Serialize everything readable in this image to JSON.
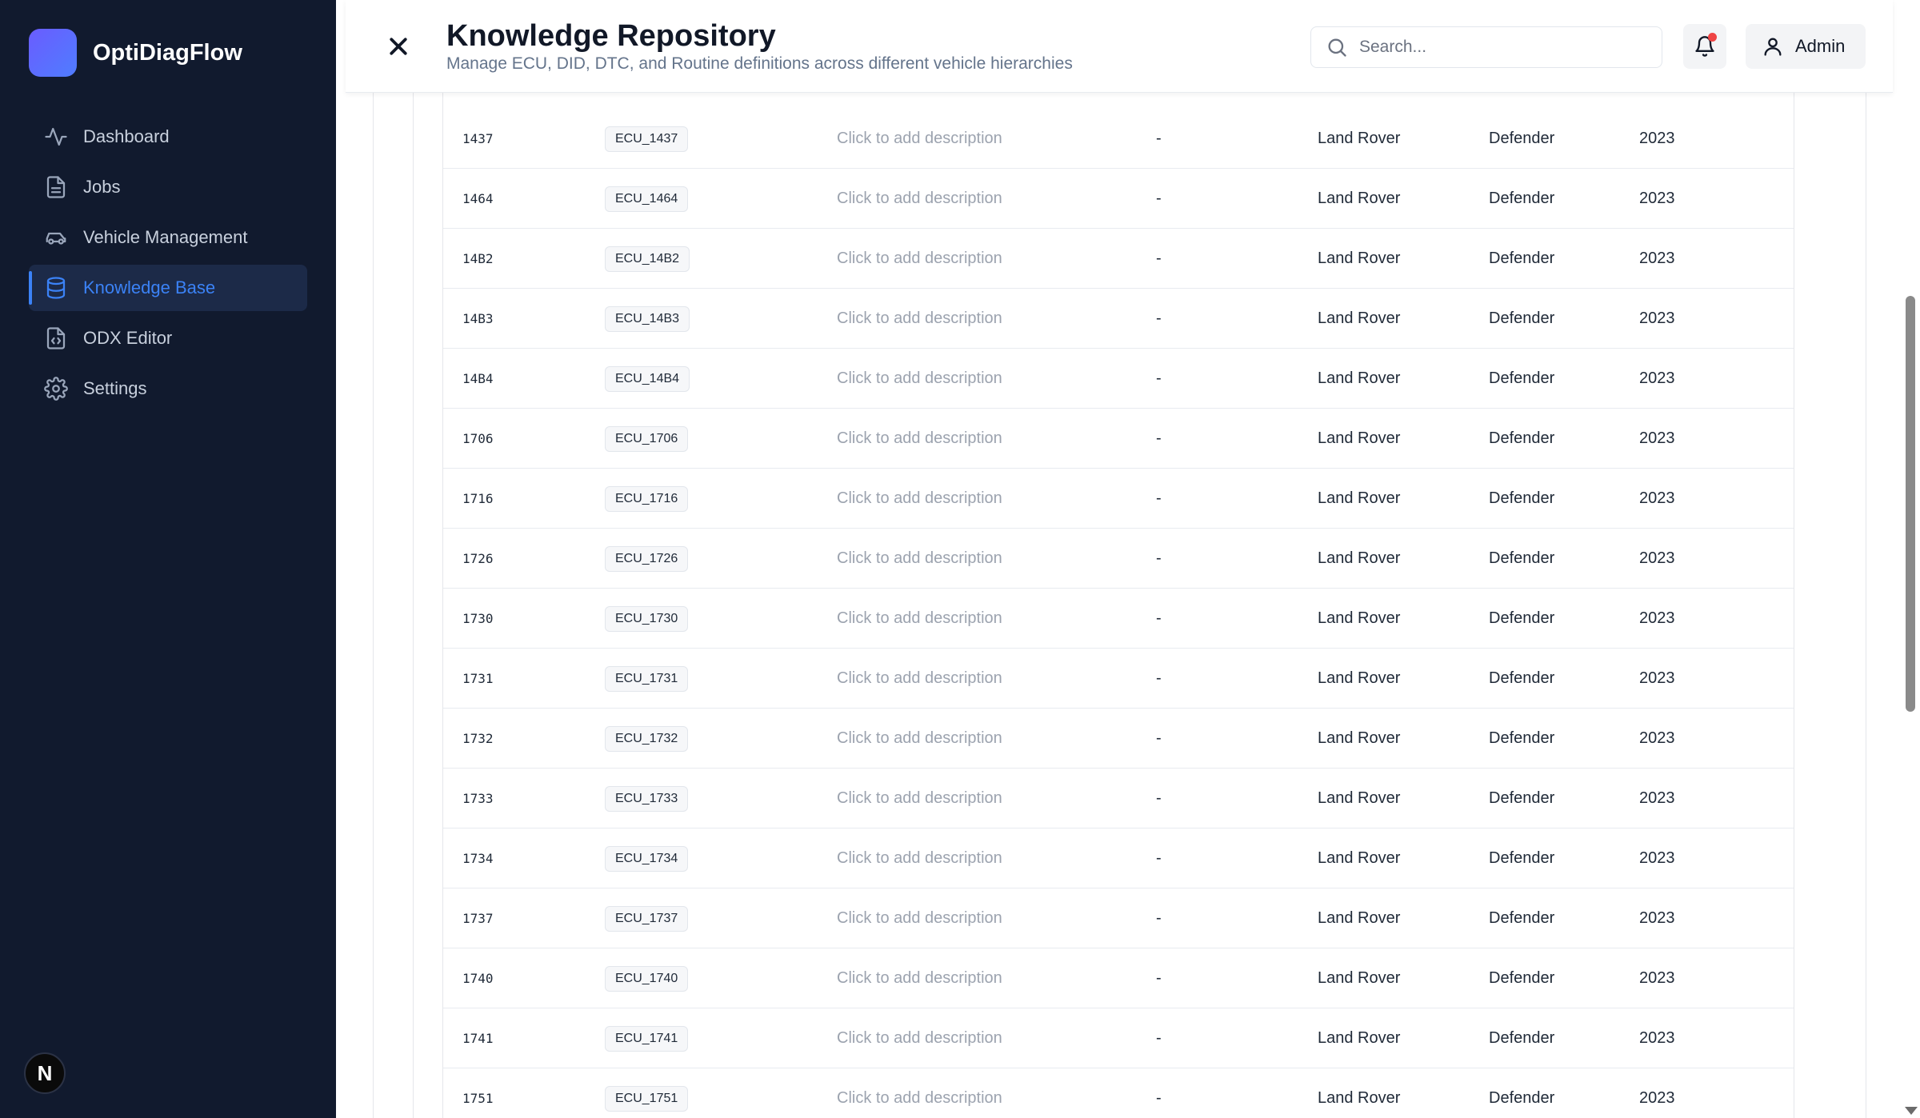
{
  "app": {
    "name": "OptiDiagFlow",
    "badge_letter": "N"
  },
  "sidebar": {
    "items": [
      {
        "label": "Dashboard",
        "icon": "activity-icon",
        "active": false
      },
      {
        "label": "Jobs",
        "icon": "document-icon",
        "active": false
      },
      {
        "label": "Vehicle Management",
        "icon": "car-icon",
        "active": false
      },
      {
        "label": "Knowledge Base",
        "icon": "database-icon",
        "active": true
      },
      {
        "label": "ODX Editor",
        "icon": "code-file-icon",
        "active": false
      },
      {
        "label": "Settings",
        "icon": "gear-icon",
        "active": false
      }
    ]
  },
  "header": {
    "title": "Knowledge Repository",
    "subtitle": "Manage ECU, DID, DTC, and Routine definitions across different vehicle hierarchies",
    "search_placeholder": "Search...",
    "user_label": "Admin"
  },
  "colors": {
    "sidebar_bg": "#111a2e",
    "accent": "#3b82f6",
    "notification_dot": "#ef4444"
  },
  "table": {
    "rows": [
      {
        "id": "1437",
        "name": "ECU_1437",
        "description": "Click to add description",
        "extra": "-",
        "make": "Land Rover",
        "model": "Defender",
        "year": "2023"
      },
      {
        "id": "1464",
        "name": "ECU_1464",
        "description": "Click to add description",
        "extra": "-",
        "make": "Land Rover",
        "model": "Defender",
        "year": "2023"
      },
      {
        "id": "14B2",
        "name": "ECU_14B2",
        "description": "Click to add description",
        "extra": "-",
        "make": "Land Rover",
        "model": "Defender",
        "year": "2023"
      },
      {
        "id": "14B3",
        "name": "ECU_14B3",
        "description": "Click to add description",
        "extra": "-",
        "make": "Land Rover",
        "model": "Defender",
        "year": "2023"
      },
      {
        "id": "14B4",
        "name": "ECU_14B4",
        "description": "Click to add description",
        "extra": "-",
        "make": "Land Rover",
        "model": "Defender",
        "year": "2023"
      },
      {
        "id": "1706",
        "name": "ECU_1706",
        "description": "Click to add description",
        "extra": "-",
        "make": "Land Rover",
        "model": "Defender",
        "year": "2023"
      },
      {
        "id": "1716",
        "name": "ECU_1716",
        "description": "Click to add description",
        "extra": "-",
        "make": "Land Rover",
        "model": "Defender",
        "year": "2023"
      },
      {
        "id": "1726",
        "name": "ECU_1726",
        "description": "Click to add description",
        "extra": "-",
        "make": "Land Rover",
        "model": "Defender",
        "year": "2023"
      },
      {
        "id": "1730",
        "name": "ECU_1730",
        "description": "Click to add description",
        "extra": "-",
        "make": "Land Rover",
        "model": "Defender",
        "year": "2023"
      },
      {
        "id": "1731",
        "name": "ECU_1731",
        "description": "Click to add description",
        "extra": "-",
        "make": "Land Rover",
        "model": "Defender",
        "year": "2023"
      },
      {
        "id": "1732",
        "name": "ECU_1732",
        "description": "Click to add description",
        "extra": "-",
        "make": "Land Rover",
        "model": "Defender",
        "year": "2023"
      },
      {
        "id": "1733",
        "name": "ECU_1733",
        "description": "Click to add description",
        "extra": "-",
        "make": "Land Rover",
        "model": "Defender",
        "year": "2023"
      },
      {
        "id": "1734",
        "name": "ECU_1734",
        "description": "Click to add description",
        "extra": "-",
        "make": "Land Rover",
        "model": "Defender",
        "year": "2023"
      },
      {
        "id": "1737",
        "name": "ECU_1737",
        "description": "Click to add description",
        "extra": "-",
        "make": "Land Rover",
        "model": "Defender",
        "year": "2023"
      },
      {
        "id": "1740",
        "name": "ECU_1740",
        "description": "Click to add description",
        "extra": "-",
        "make": "Land Rover",
        "model": "Defender",
        "year": "2023"
      },
      {
        "id": "1741",
        "name": "ECU_1741",
        "description": "Click to add description",
        "extra": "-",
        "make": "Land Rover",
        "model": "Defender",
        "year": "2023"
      },
      {
        "id": "1751",
        "name": "ECU_1751",
        "description": "Click to add description",
        "extra": "-",
        "make": "Land Rover",
        "model": "Defender",
        "year": "2023"
      }
    ]
  }
}
